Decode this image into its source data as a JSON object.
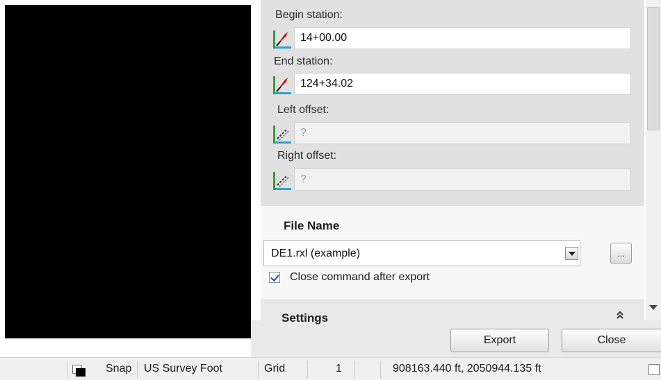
{
  "form": {
    "begin_station": {
      "label": "Begin station:",
      "value": "14+00.00"
    },
    "end_station": {
      "label": "End station:",
      "value": "124+34.02"
    },
    "left_offset": {
      "label": "Left offset:",
      "value": "?"
    },
    "right_offset": {
      "label": "Right offset:",
      "value": "?"
    }
  },
  "file": {
    "title": "File Name",
    "selected": "DE1.rxl (example)",
    "browse_label": "..."
  },
  "options": {
    "close_after_export": "Close command after export",
    "close_after_export_checked": true
  },
  "settings": {
    "title": "Settings",
    "collapse_glyph": "⌃"
  },
  "buttons": {
    "export": "Export",
    "close": "Close"
  },
  "statusbar": {
    "snap": "Snap",
    "units": "US Survey Foot",
    "grid": "Grid",
    "grid_value": "1",
    "coordinates": "908163.440 ft, 2050944.135 ft"
  },
  "icons": {
    "station": "station-pick-icon",
    "offset": "offset-pick-icon"
  },
  "colors": {
    "viewport": "#000000",
    "panel": "#e1e1e1",
    "station_icon_red": "#cc1f1f",
    "offset_icon_green": "#3a9a3a"
  }
}
